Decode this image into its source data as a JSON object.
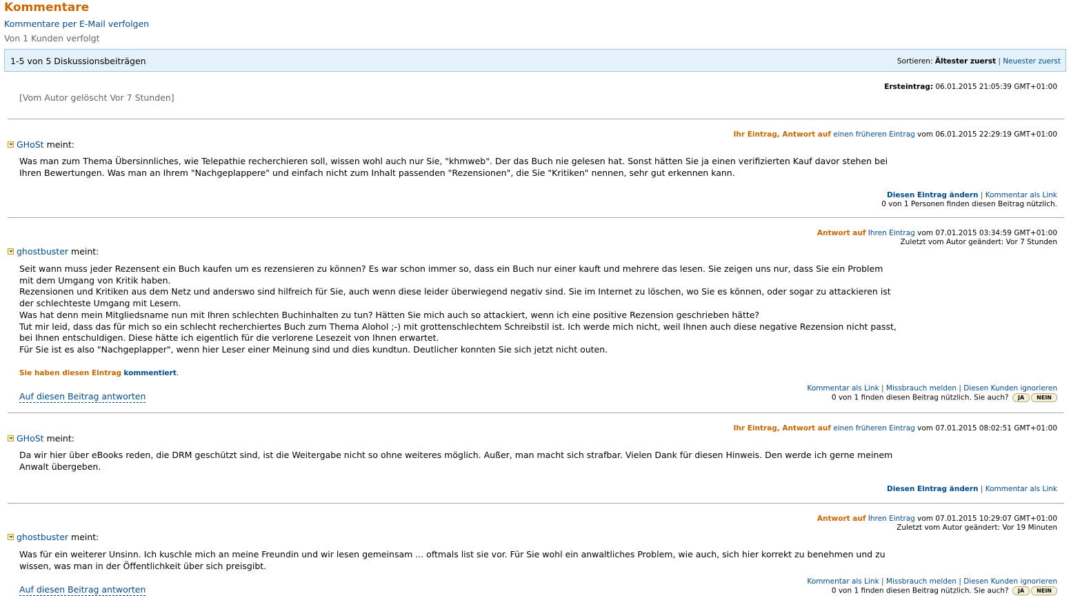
{
  "header": {
    "title": "Kommentare",
    "follow_email": "Kommentare per E-Mail verfolgen",
    "followers": "Von 1 Kunden verfolgt"
  },
  "bar": {
    "count": "1-5 von 5 Diskussionsbeiträgen",
    "sort_label": "Sortieren:",
    "sort_oldest": "Ältester zuerst",
    "sort_sep": "|",
    "sort_newest": "Neuester zuerst"
  },
  "first": {
    "deleted": "[Vom Autor gelöscht Vor 7 Stunden]",
    "label": "Ersteintrag:",
    "date": "06.01.2015 21:05:39 GMT+01:00"
  },
  "posts": [
    {
      "meta_orange": "Ihr Eintrag, Antwort auf",
      "meta_link": "einen früheren Eintrag",
      "meta_date": "vom 06.01.2015 22:29:19 GMT+01:00",
      "author": "GHoSt",
      "says": "meint:",
      "lines": [
        "Was man zum Thema Übersinnliches, wie Telepathie recherchieren soll, wissen wohl auch nur Sie, \"khmweb\". Der das Buch nie gelesen hat. Sonst hätten Sie ja einen verifizierten Kauf davor stehen bei",
        "Ihren Bewertungen. Was man an Ihrem \"Nachgeplappere\" und einfach nicht zum Inhalt passenden \"Rezensionen\", die Sie \"Kritiken\" nennen, sehr gut erkennen kann."
      ],
      "edit": "Diesen Eintrag ändern",
      "sep": "|",
      "permalink": "Kommentar als Link",
      "helpful": "0 von 1 Personen finden diesen Beitrag nützlich."
    },
    {
      "meta_orange": "Antwort auf",
      "meta_link": "Ihren Eintrag",
      "meta_date": "vom 07.01.2015 03:34:59 GMT+01:00",
      "edited": "Zuletzt vom Autor geändert: Vor 7 Stunden",
      "author": "ghostbuster",
      "says": "meint:",
      "lines": [
        "Seit wann muss jeder Rezensent ein Buch kaufen um es rezensieren zu können? Es war schon immer so, dass ein Buch nur einer kauft und mehrere das lesen. Sie zeigen uns nur, dass Sie ein Problem",
        "mit dem Umgang von Kritik haben.",
        "Rezensionen und Kritiken aus dem Netz und anderswo sind hilfreich für Sie, auch wenn diese leider überwiegend negativ sind. Sie im Internet zu löschen, wo Sie es können, oder sogar zu attackieren ist",
        "der schlechteste Umgang mit Lesern.",
        "Was hat denn mein Mitgliedsname nun mit Ihren schlechten Buchinhalten zu tun? Hätten Sie mich auch so attackiert, wenn ich eine positive Rezension geschrieben hätte?",
        "Tut mir leid, dass das für mich so ein schlecht recherchiertes Buch zum Thema Alohol ;-) mit grottenschlechtem Schreibstil ist. Ich werde mich nicht, weil Ihnen auch diese negative Rezension nicht passt,",
        "bei Ihnen entschuldigen. Diese hätte ich eigentlich für die verlorene Lesezeit von Ihnen erwartet.",
        "Für Sie ist es also \"Nachgeplapper\", wenn hier Leser einer Meinung sind und dies kundtun. Deutlicher konnten Sie sich jetzt nicht outen."
      ],
      "commented_prefix": "Sie haben diesen Eintrag",
      "commented_link": "kommentiert",
      "commented_suffix": ".",
      "reply": "Auf diesen Beitrag antworten",
      "permalink": "Kommentar als Link",
      "sep": "|",
      "report": "Missbrauch melden",
      "ignore": "Diesen Kunden ignorieren",
      "helpful": "0 von 1 finden diesen Beitrag nützlich. Sie auch?",
      "yes": "JA",
      "no": "NEIN"
    },
    {
      "meta_orange": "Ihr Eintrag, Antwort auf",
      "meta_link": "einen früheren Eintrag",
      "meta_date": "vom 07.01.2015 08:02:51 GMT+01:00",
      "author": "GHoSt",
      "says": "meint:",
      "lines": [
        "Da wir hier über eBooks reden, die DRM geschützt sind, ist die Weitergabe nicht so ohne weiteres möglich. Außer, man macht sich strafbar. Vielen Dank für diesen Hinweis. Den werde ich gerne meinem",
        "Anwalt übergeben."
      ],
      "edit": "Diesen Eintrag ändern",
      "sep": "|",
      "permalink": "Kommentar als Link"
    },
    {
      "meta_orange": "Antwort auf",
      "meta_link": "Ihren Eintrag",
      "meta_date": "vom 07.01.2015 10:29:07 GMT+01:00",
      "edited": "Zuletzt vom Autor geändert: Vor 19 Minuten",
      "author": "ghostbuster",
      "says": "meint:",
      "lines": [
        "Was für ein weiterer Unsinn. Ich kuschle mich an meine Freundin und wir lesen gemeinsam ... oftmals list sie vor. Für Sie wohl ein anwaltliches Problem, wie auch, sich hier korrekt zu benehmen und zu",
        "wissen, was man in der Öffentlichkeit über sich preisgibt."
      ],
      "reply": "Auf diesen Beitrag antworten",
      "permalink": "Kommentar als Link",
      "sep": "|",
      "report": "Missbrauch melden",
      "ignore": "Diesen Kunden ignorieren",
      "helpful": "0 von 1 finden diesen Beitrag nützlich. Sie auch?",
      "yes": "JA",
      "no": "NEIN"
    }
  ]
}
